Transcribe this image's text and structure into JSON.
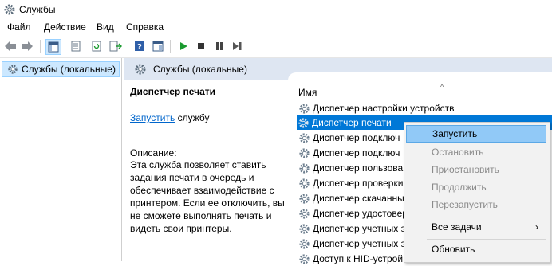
{
  "window": {
    "title": "Службы",
    "app_icon": "gear-icon"
  },
  "menu": [
    "Файл",
    "Действие",
    "Вид",
    "Справка"
  ],
  "toolbar": {
    "icons": [
      "back-arrow-icon",
      "forward-arrow-icon",
      "console-tree-icon",
      "properties-icon",
      "refresh-icon",
      "export-list-icon",
      "help-icon",
      "action-pane-icon",
      "play-icon",
      "stop-icon",
      "pause-icon",
      "restart-icon"
    ],
    "colors": {
      "play": "#1a9a2f",
      "stop": "#333333",
      "pause": "#444444"
    }
  },
  "tree": {
    "items": [
      {
        "label": "Службы (локальные)",
        "icon": "gear-icon"
      }
    ]
  },
  "pane_header": {
    "title": "Службы (локальные)"
  },
  "detail": {
    "service_name": "Диспетчер печати",
    "start_link": "Запустить",
    "start_suffix": " службу",
    "description_label": "Описание:",
    "description_text": "Эта служба позволяет ставить задания печати в очередь и обеспечивает взаимодействие с принтером. Если ее отключить, вы не сможете выполнять печать и видеть свои принтеры."
  },
  "list": {
    "sort_indicator": "^",
    "column_name": "Имя",
    "rows": [
      "Диспетчер настройки устройств",
      "Диспетчер печати",
      "Диспетчер подключ",
      "Диспетчер подключ",
      "Диспетчер пользова",
      "Диспетчер проверки",
      "Диспетчер скачанны",
      "Диспетчер удостовер",
      "Диспетчер учетных з",
      "Диспетчер учетных з",
      "Доступ к HID-устрой"
    ],
    "selected_index": 1,
    "selection_color": "#0078d7"
  },
  "context_menu": {
    "items": [
      {
        "label": "Запустить",
        "state": "highlighted"
      },
      {
        "label": "Остановить",
        "state": "disabled"
      },
      {
        "label": "Приостановить",
        "state": "disabled"
      },
      {
        "label": "Продолжить",
        "state": "disabled"
      },
      {
        "label": "Перезапустить",
        "state": "disabled"
      },
      {
        "label": "Все задачи",
        "state": "submenu",
        "arrow": "›"
      },
      {
        "label": "Обновить",
        "state": "normal"
      }
    ]
  }
}
